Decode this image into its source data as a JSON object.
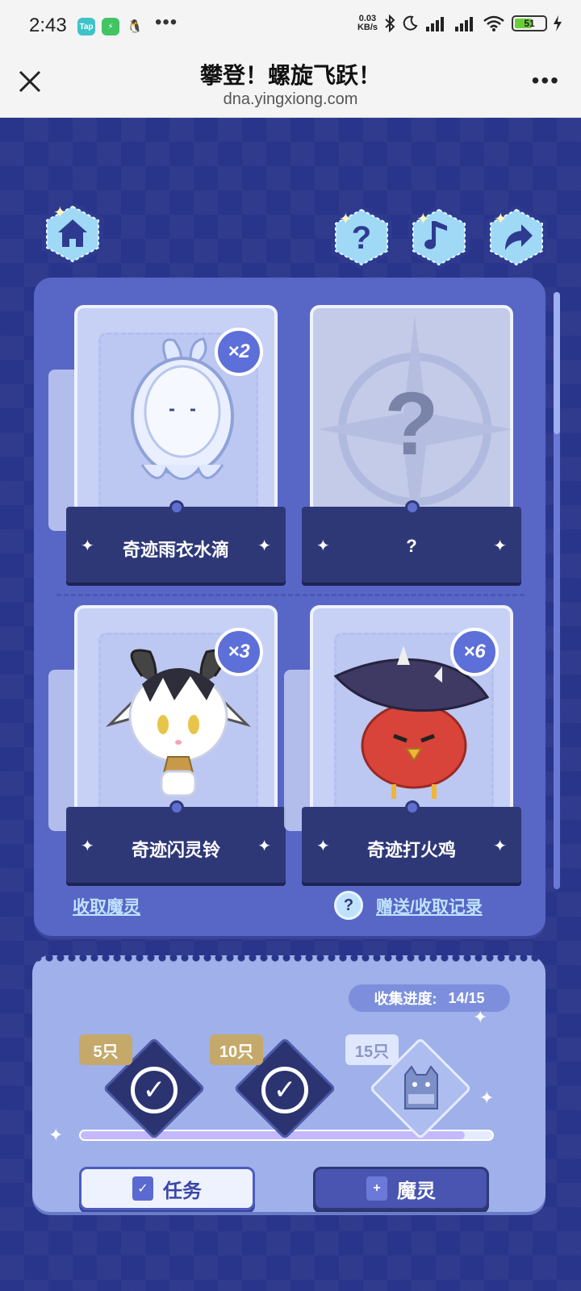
{
  "status_bar": {
    "time": "2:43",
    "app_icons": [
      {
        "name": "taptap-icon",
        "label": "Tap",
        "color": "#3fc3c9"
      },
      {
        "name": "battery-saver-app-icon",
        "label": "⚡",
        "color": "#42c463"
      },
      {
        "name": "qq-icon",
        "label": "🐧",
        "color": "#f4f4f4"
      }
    ],
    "overflow": "•••",
    "net_speed_value": "0.03",
    "net_speed_unit": "KB/s",
    "battery": "51"
  },
  "browser": {
    "title": "攀登！螺旋飞跃！",
    "url": "dna.yingxiong.com",
    "more": "•••"
  },
  "top_buttons": {
    "home": "home-icon",
    "help": "question-icon",
    "music": "music-note-icon",
    "share": "share-icon"
  },
  "cards": [
    {
      "name": "奇迹雨衣水滴",
      "count": "×2",
      "owned": true
    },
    {
      "name": "?",
      "count": "",
      "owned": false
    },
    {
      "name": "奇迹闪灵铃",
      "count": "×3",
      "owned": true
    },
    {
      "name": "奇迹打火鸡",
      "count": "×6",
      "owned": true
    }
  ],
  "links": {
    "collect": "收取魔灵",
    "records_icon": "?",
    "records": "赠送/收取记录"
  },
  "progress": {
    "label": "收集进度:",
    "value": "14/15",
    "current": 14,
    "total": 15,
    "milestones": [
      {
        "label": "5只",
        "claimed": true
      },
      {
        "label": "10只",
        "claimed": true
      },
      {
        "label": "15只",
        "claimed": false
      }
    ]
  },
  "buttons": {
    "task": "任务",
    "spirit": "魔灵"
  }
}
